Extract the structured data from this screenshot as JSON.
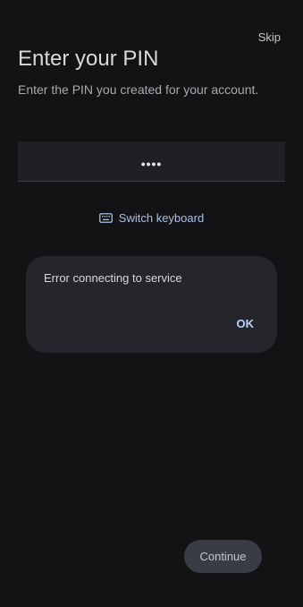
{
  "header": {
    "skip_label": "Skip",
    "title": "Enter your PIN",
    "subtitle": "Enter the PIN you created for your account."
  },
  "pin": {
    "value": "••••"
  },
  "keyboard_toggle": {
    "icon": "keyboard-icon",
    "label": "Switch keyboard"
  },
  "dialog": {
    "message": "Error connecting to service",
    "ok_label": "OK"
  },
  "footer": {
    "continue_label": "Continue"
  },
  "colors": {
    "background": "#121315",
    "accent_text": "#aebfe8",
    "dialog_bg": "#25262b",
    "button_bg": "#3a3c45"
  }
}
